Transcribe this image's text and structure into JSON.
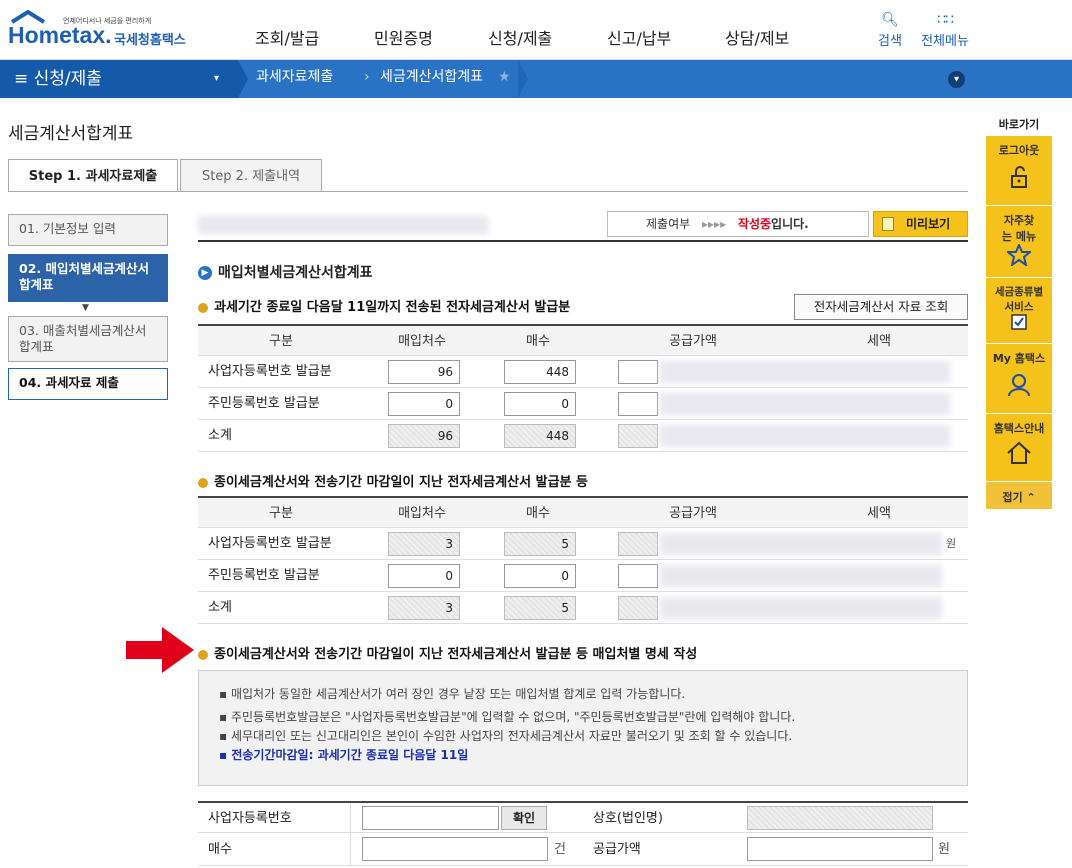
{
  "header": {
    "logo_sub": "언제어디서나 세금을 편리하게",
    "logo_text": "Hometax.",
    "logo_kor": "국세청홈택스",
    "menu": [
      "조회/발급",
      "민원증명",
      "신청/제출",
      "신고/납부",
      "상담/제보"
    ],
    "search_label": "검색",
    "all_menu_label": "전체메뉴"
  },
  "nav": {
    "section": "신청/제출",
    "crumbs": [
      "과세자료제출",
      "세금계산서합계표"
    ]
  },
  "page_title": "세금계산서합계표",
  "tabs": [
    "Step 1. 과세자료제출",
    "Step 2. 제출내역"
  ],
  "steps": [
    "01. 기본정보 입력",
    "02. 매입처별세금계산서합계표",
    "03. 매출처별세금계산서합계표",
    "04. 과세자료 제출"
  ],
  "status": {
    "label": "제출여부",
    "arrows": "▸▸▸▸",
    "state": "작성중",
    "suffix": "입니다.",
    "preview": "미리보기"
  },
  "section_title": "매입처별세금계산서합계표",
  "sec1": {
    "title": "과세기간 종료일 다음달 11일까지 전송된 전자세금계산서 발급분",
    "btn": "전자세금계산서 자료 조회"
  },
  "columns": [
    "구분",
    "매입처수",
    "매수",
    "공급가액",
    "세액"
  ],
  "table1": [
    {
      "label": "사업자등록번호 발급분",
      "a": "96",
      "b": "448"
    },
    {
      "label": "주민등록번호 발급분",
      "a": "0",
      "b": "0"
    },
    {
      "label": "소계",
      "a": "96",
      "b": "448"
    }
  ],
  "sec2": {
    "title": "종이세금계산서와 전송기간 마감일이 지난 전자세금계산서 발급분 등"
  },
  "table2": [
    {
      "label": "사업자등록번호 발급분",
      "a": "3",
      "b": "5",
      "unit": "원"
    },
    {
      "label": "주민등록번호 발급분",
      "a": "0",
      "b": "0"
    },
    {
      "label": "소계",
      "a": "3",
      "b": "5"
    }
  ],
  "sec3": {
    "title": "종이세금계산서와 전송기간 마감일이 지난 전자세금계산서 발급분 등 매입처별 명세 작성"
  },
  "notice": [
    "매입처가 동일한 세금계산서가 여러 장인 경우 낱장 또는 매입처별 합계로 입력 가능합니다.",
    "주민등록번호발급분은 \"사업자등록번호발급분\"에 입력할 수 없으며, \"주민등록번호발급분\"란에 입력해야 합니다.",
    "세무대리인 또는 신고대리인은 본인이 수임한 사업자의 전자세금계산서 자료만 불러오기 및 조회 할 수 있습니다.",
    "전송기간마감일: 과세기간 종료일 다음달 11일"
  ],
  "form": {
    "bizno": "사업자등록번호",
    "confirm": "확인",
    "company": "상호(법인명)",
    "count": "매수",
    "count_unit": "건",
    "supply": "공급가액",
    "supply_unit": "원"
  },
  "quick": {
    "title": "바로가기",
    "items": [
      "로그아웃",
      "자주찾는 메뉴",
      "세금종류별 서비스",
      "My 홈택스",
      "홈택스안내"
    ],
    "fold": "접기"
  },
  "colors": {
    "primary": "#2a73c4",
    "dark": "#155aa8",
    "yellow": "#f5c21b",
    "red": "#e0001a"
  }
}
